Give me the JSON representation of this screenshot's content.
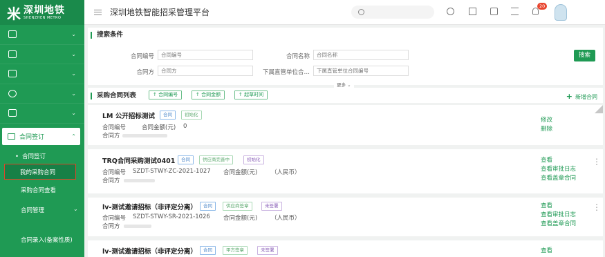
{
  "brand": {
    "logo_mark": "米",
    "name_cn": "深圳地铁",
    "name_en": "SHENZHEN METRO"
  },
  "header": {
    "title": "深圳地铁智能招采管理平台",
    "notification_count": "20"
  },
  "sidebar": {
    "icon_items": [
      {
        "icon": "home-icon"
      },
      {
        "icon": "calendar-icon"
      },
      {
        "icon": "document-icon"
      },
      {
        "icon": "coin-icon"
      },
      {
        "icon": "book-icon"
      }
    ],
    "contract_section": "合同签订",
    "sub_items": {
      "contract_signing": "合同签订",
      "my_purchases": "我的采购合同",
      "purchase_view": "采购合同查看",
      "contract_manage": "合同管理",
      "contract_entry": "合同录入(备案性质)"
    }
  },
  "search": {
    "title": "搜索条件",
    "fields": {
      "contract_no_label": "合同编号",
      "contract_no_placeholder": "合同编号",
      "contract_name_label": "合同名称",
      "contract_name_placeholder": "合同名称",
      "party_label": "合同方",
      "party_placeholder": "合同方",
      "sub_unit_label": "下属直管单位合…",
      "sub_unit_placeholder": "下属直管单位合同编号"
    },
    "search_button": "搜索",
    "more": "更多 ⌄"
  },
  "list": {
    "title": "采购合同列表",
    "sort_buttons": [
      "↑ 合同编号",
      "↑ 合同金额",
      "↑ 起草时间"
    ],
    "add_button": "新增合同",
    "add_icon": "+",
    "cards": [
      {
        "title": "LM 公开招标测试",
        "tags": [
          "合同",
          "初始化"
        ],
        "no_label": "合同编号",
        "no_value": "",
        "amount_label": "合同金额(元)",
        "amount_value": "0",
        "party_label": "合同方",
        "actions": [
          "修改",
          "删除"
        ]
      },
      {
        "title": "TRQ合同采购测试0401",
        "tags": [
          "合同",
          "供应商完善中",
          "初始化"
        ],
        "no_label": "合同编号",
        "no_value": "SZDT-STWY-ZC-2021-1027",
        "amount_label": "合同金额(元)",
        "amount_value": "（人民币）",
        "party_label": "合同方",
        "actions": [
          "查看",
          "查看审批日志",
          "查看盖章合同"
        ]
      },
      {
        "title": "lv-测试邀请招标（非评定分离）",
        "tags": [
          "合同",
          "供应商签章",
          "未签署"
        ],
        "no_label": "合同编号",
        "no_value": "SZDT-STWY-SR-2021-1026",
        "amount_label": "合同金额(元)",
        "amount_value": "（人民币）",
        "party_label": "合同方",
        "actions": [
          "查看",
          "查看审批日志",
          "查看盖章合同"
        ]
      },
      {
        "title": "lv-测试邀请招标（非评定分离）",
        "tags": [
          "合同",
          "甲方签章",
          "未签署"
        ],
        "actions": [
          "查看"
        ]
      }
    ]
  }
}
